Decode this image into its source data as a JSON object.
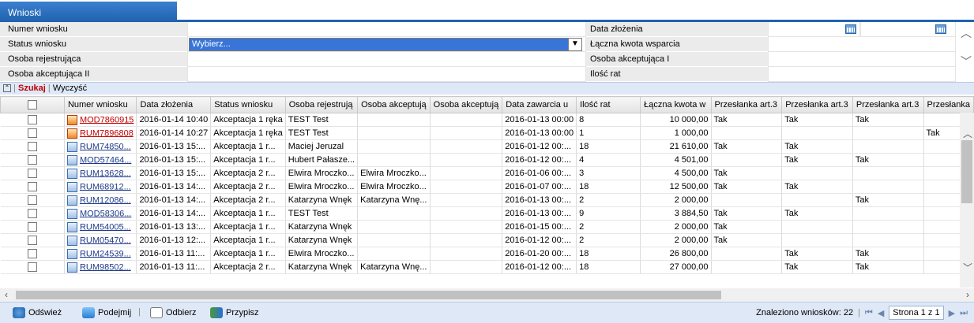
{
  "tab": {
    "title": "Wnioski"
  },
  "filters": {
    "left": [
      {
        "label": "Numer wniosku",
        "value": ""
      },
      {
        "label": "Status wniosku",
        "value": ""
      },
      {
        "label": "Osoba rejestrująca",
        "value": ""
      },
      {
        "label": "Osoba akceptująca II",
        "value": ""
      }
    ],
    "right": [
      {
        "label": "Data złożenia",
        "value": ""
      },
      {
        "label": "Łączna kwota wsparcia",
        "value": ""
      },
      {
        "label": "Osoba akceptująca I",
        "value": ""
      },
      {
        "label": "Ilość rat",
        "value": ""
      }
    ],
    "status_select": "Wybierz..."
  },
  "actions": {
    "search": "Szukaj",
    "clear": "Wyczyść"
  },
  "columns": [
    "Numer wniosku",
    "Data złożenia",
    "Status wniosku",
    "Osoba rejestrują",
    "Osoba akceptują",
    "Osoba akceptują",
    "Data zawarcia u",
    "Ilość rat",
    "Łączna kwota w",
    "Przesłanka art.3",
    "Przesłanka art.3",
    "Przesłanka art.3",
    "Przesłanka"
  ],
  "rows": [
    {
      "icon": "red",
      "num": "MOD7860915",
      "date": "2016-01-14 10:40",
      "status": "Akceptacja 1 ręka",
      "reg": "TEST Test",
      "acc1": "",
      "acc2": "",
      "contract": "2016-01-13 00:00",
      "rat": "8",
      "amount": "10 000,00",
      "p1": "Tak",
      "p2": "Tak",
      "p3": "Tak",
      "p4": ""
    },
    {
      "icon": "red",
      "num": "RUM7896808",
      "date": "2016-01-14 10:27",
      "status": "Akceptacja 1 ręka",
      "reg": "TEST Test",
      "acc1": "",
      "acc2": "",
      "contract": "2016-01-13 00:00",
      "rat": "1",
      "amount": "1 000,00",
      "p1": "",
      "p2": "",
      "p3": "",
      "p4": "Tak"
    },
    {
      "icon": "blue",
      "num": "RUM74850...",
      "date": "2016-01-13 15:...",
      "status": "Akceptacja 1 r...",
      "reg": "Maciej Jeruzal",
      "acc1": "",
      "acc2": "",
      "contract": "2016-01-12 00:...",
      "rat": "18",
      "amount": "21 610,00",
      "p1": "Tak",
      "p2": "Tak",
      "p3": "",
      "p4": ""
    },
    {
      "icon": "blue",
      "num": "MOD57464...",
      "date": "2016-01-13 15:...",
      "status": "Akceptacja 1 r...",
      "reg": "Hubert Pałasze...",
      "acc1": "",
      "acc2": "",
      "contract": "2016-01-12 00:...",
      "rat": "4",
      "amount": "4 501,00",
      "p1": "",
      "p2": "Tak",
      "p3": "Tak",
      "p4": ""
    },
    {
      "icon": "blue",
      "num": "RUM13628...",
      "date": "2016-01-13 15:...",
      "status": "Akceptacja 2 r...",
      "reg": "Elwira Mroczko...",
      "acc1": "Elwira Mroczko...",
      "acc2": "",
      "contract": "2016-01-06 00:...",
      "rat": "3",
      "amount": "4 500,00",
      "p1": "Tak",
      "p2": "",
      "p3": "",
      "p4": ""
    },
    {
      "icon": "blue",
      "num": "RUM68912...",
      "date": "2016-01-13 14:...",
      "status": "Akceptacja 2 r...",
      "reg": "Elwira Mroczko...",
      "acc1": "Elwira Mroczko...",
      "acc2": "",
      "contract": "2016-01-07 00:...",
      "rat": "18",
      "amount": "12 500,00",
      "p1": "Tak",
      "p2": "Tak",
      "p3": "",
      "p4": ""
    },
    {
      "icon": "blue",
      "num": "RUM12086...",
      "date": "2016-01-13 14:...",
      "status": "Akceptacja 2 r...",
      "reg": "Katarzyna Wnęk",
      "acc1": "Katarzyna Wnę...",
      "acc2": "",
      "contract": "2016-01-13 00:...",
      "rat": "2",
      "amount": "2 000,00",
      "p1": "",
      "p2": "",
      "p3": "Tak",
      "p4": ""
    },
    {
      "icon": "blue",
      "num": "MOD58306...",
      "date": "2016-01-13 14:...",
      "status": "Akceptacja 1 r...",
      "reg": "TEST Test",
      "acc1": "",
      "acc2": "",
      "contract": "2016-01-13 00:...",
      "rat": "9",
      "amount": "3 884,50",
      "p1": "Tak",
      "p2": "Tak",
      "p3": "",
      "p4": ""
    },
    {
      "icon": "blue",
      "num": "RUM54005...",
      "date": "2016-01-13 13:...",
      "status": "Akceptacja 1 r...",
      "reg": "Katarzyna Wnęk",
      "acc1": "",
      "acc2": "",
      "contract": "2016-01-15 00:...",
      "rat": "2",
      "amount": "2 000,00",
      "p1": "Tak",
      "p2": "",
      "p3": "",
      "p4": ""
    },
    {
      "icon": "blue",
      "num": "RUM05470...",
      "date": "2016-01-13 12:...",
      "status": "Akceptacja 1 r...",
      "reg": "Katarzyna Wnęk",
      "acc1": "",
      "acc2": "",
      "contract": "2016-01-12 00:...",
      "rat": "2",
      "amount": "2 000,00",
      "p1": "Tak",
      "p2": "",
      "p3": "",
      "p4": ""
    },
    {
      "icon": "blue",
      "num": "RUM24539...",
      "date": "2016-01-13 11:...",
      "status": "Akceptacja 1 r...",
      "reg": "Elwira Mroczko...",
      "acc1": "",
      "acc2": "",
      "contract": "2016-01-20 00:...",
      "rat": "18",
      "amount": "26 800,00",
      "p1": "",
      "p2": "Tak",
      "p3": "Tak",
      "p4": ""
    },
    {
      "icon": "blue",
      "num": "RUM98502...",
      "date": "2016-01-13 11:...",
      "status": "Akceptacja 2 r...",
      "reg": "Katarzyna Wnęk",
      "acc1": "Katarzyna Wnę...",
      "acc2": "",
      "contract": "2016-01-12 00:...",
      "rat": "18",
      "amount": "27 000,00",
      "p1": "",
      "p2": "Tak",
      "p3": "Tak",
      "p4": ""
    }
  ],
  "footer": {
    "refresh": "Odśwież",
    "take": "Podejmij",
    "release": "Odbierz",
    "assign": "Przypisz",
    "found": "Znaleziono wniosków: 22",
    "page": "Strona 1 z 1"
  },
  "colors": {
    "accent": "#1f62ad",
    "link": "#1f3a8a",
    "search": "#c00000"
  }
}
